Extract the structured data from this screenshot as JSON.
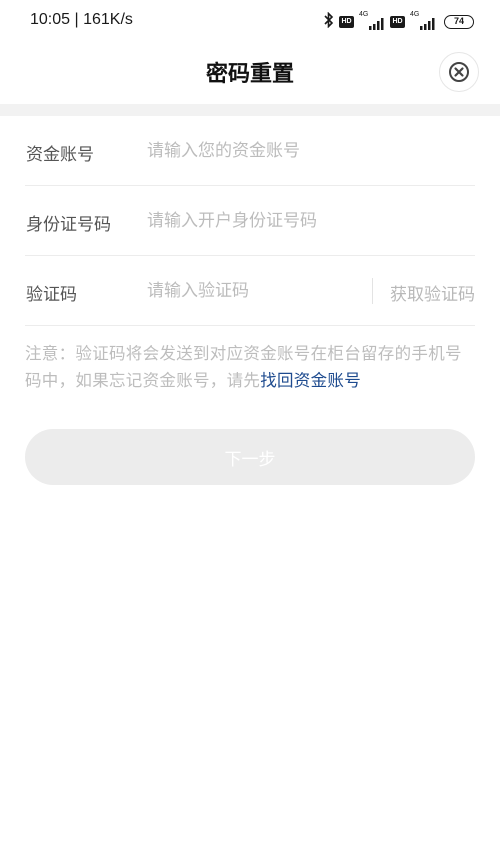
{
  "status_bar": {
    "time": "10:05 | 161K/s",
    "hd_label": "HD",
    "network_4g": "4G",
    "battery": "74"
  },
  "header": {
    "title": "密码重置"
  },
  "form": {
    "account": {
      "label": "资金账号",
      "placeholder": "请输入您的资金账号"
    },
    "id_number": {
      "label": "身份证号码",
      "placeholder": "请输入开户身份证号码"
    },
    "code": {
      "label": "验证码",
      "placeholder": "请输入验证码",
      "get_code": "获取验证码"
    }
  },
  "note": {
    "text": "注意：验证码将会发送到对应资金账号在柜台留存的手机号码中，如果忘记资金账号，请先",
    "link": "找回资金账号"
  },
  "next_button": "下一步",
  "colors": {
    "link": "#1e4b8f",
    "disabled_button": "#ececec",
    "placeholder": "#bcbcbc"
  }
}
